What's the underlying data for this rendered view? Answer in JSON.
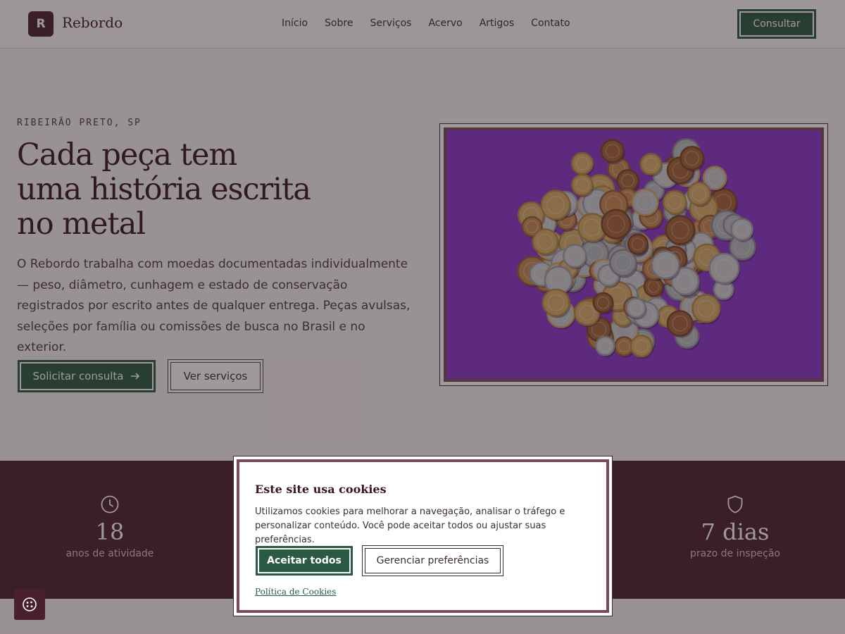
{
  "header": {
    "logo_letter": "R",
    "brand": "Rebordo",
    "nav": [
      "Início",
      "Sobre",
      "Serviços",
      "Acervo",
      "Artigos",
      "Contato"
    ],
    "cta_label": "Consultar"
  },
  "hero": {
    "eyebrow": "RIBEIRÃO PRETO, SP",
    "title_line1": "Cada peça tem",
    "title_line2": "uma história escrita",
    "title_line3": "no metal",
    "text": "O Rebordo trabalha com moedas documentadas individualmente — peso, diâmetro, cunhagem e estado de conservação registrados por escrito antes de qualquer entrega. Peças avulsas, seleções por família ou comissões de busca no Brasil e no exterior.",
    "primary_label": "Solicitar consulta",
    "secondary_label": "Ver serviços"
  },
  "stats": [
    {
      "icon": "clock-icon",
      "value": "18",
      "label": "anos de atividade"
    },
    {
      "icon": "shield-icon",
      "value": "7 dias",
      "label": "prazo de inspeção"
    }
  ],
  "cookie": {
    "title": "Este site usa cookies",
    "text": "Utilizamos cookies para melhorar a navegação, analisar o tráfego e personalizar conteúdo. Você pode aceitar todos ou ajustar suas preferências.",
    "accept_label": "Aceitar todos",
    "manage_label": "Gerenciar preferências",
    "policy_label": "Política de Cookies"
  },
  "colors": {
    "brand": "#4a1f2e",
    "accent_green": "#2b5a42",
    "image_background": "#8b35c9"
  }
}
